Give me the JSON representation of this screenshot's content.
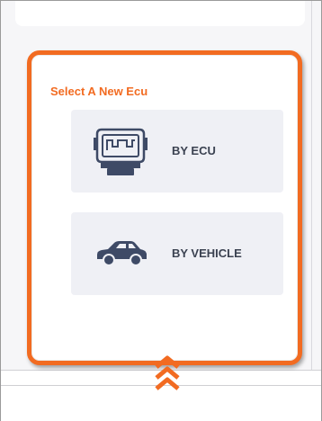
{
  "panel": {
    "title": "Select A New Ecu",
    "options": [
      {
        "label": "BY ECU",
        "icon": "ecu-module-icon"
      },
      {
        "label": "BY VEHICLE",
        "icon": "car-icon"
      }
    ]
  },
  "colors": {
    "accent": "#f26b21",
    "option_bg": "#eff0f5",
    "icon": "#3e4a66",
    "text": "#3b4251"
  }
}
